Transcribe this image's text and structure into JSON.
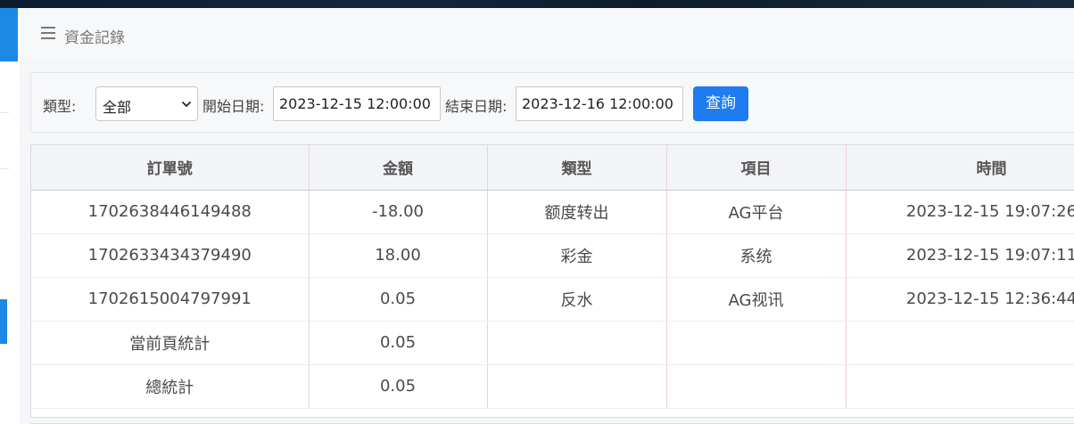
{
  "header": {
    "title": "資金記錄"
  },
  "filter": {
    "type_label": "類型:",
    "type_value": "全部",
    "start_label": "開始日期:",
    "start_value": "2023-12-15 12:00:00",
    "end_label": "結束日期:",
    "end_value": "2023-12-16 12:00:00",
    "query_label": "查詢"
  },
  "table": {
    "columns": [
      "訂單號",
      "金額",
      "類型",
      "項目",
      "時間"
    ],
    "rows": [
      [
        "1702638446149488",
        "-18.00",
        "额度转出",
        "AG平台",
        "2023-12-15 19:07:26"
      ],
      [
        "1702633434379490",
        "18.00",
        "彩金",
        "系统",
        "2023-12-15 19:07:11"
      ],
      [
        "1702615004797991",
        "0.05",
        "反水",
        "AG视讯",
        "2023-12-15 12:36:44"
      ],
      [
        "當前頁統計",
        "0.05",
        "",
        "",
        ""
      ],
      [
        "總統計",
        "0.05",
        "",
        "",
        ""
      ]
    ]
  },
  "colors": {
    "accent": "#1e7bf0",
    "nav_accent": "#1e88e5"
  },
  "icons": {
    "menu": "hamburger-menu-icon",
    "select_chevron": "chevron-down-icon"
  }
}
